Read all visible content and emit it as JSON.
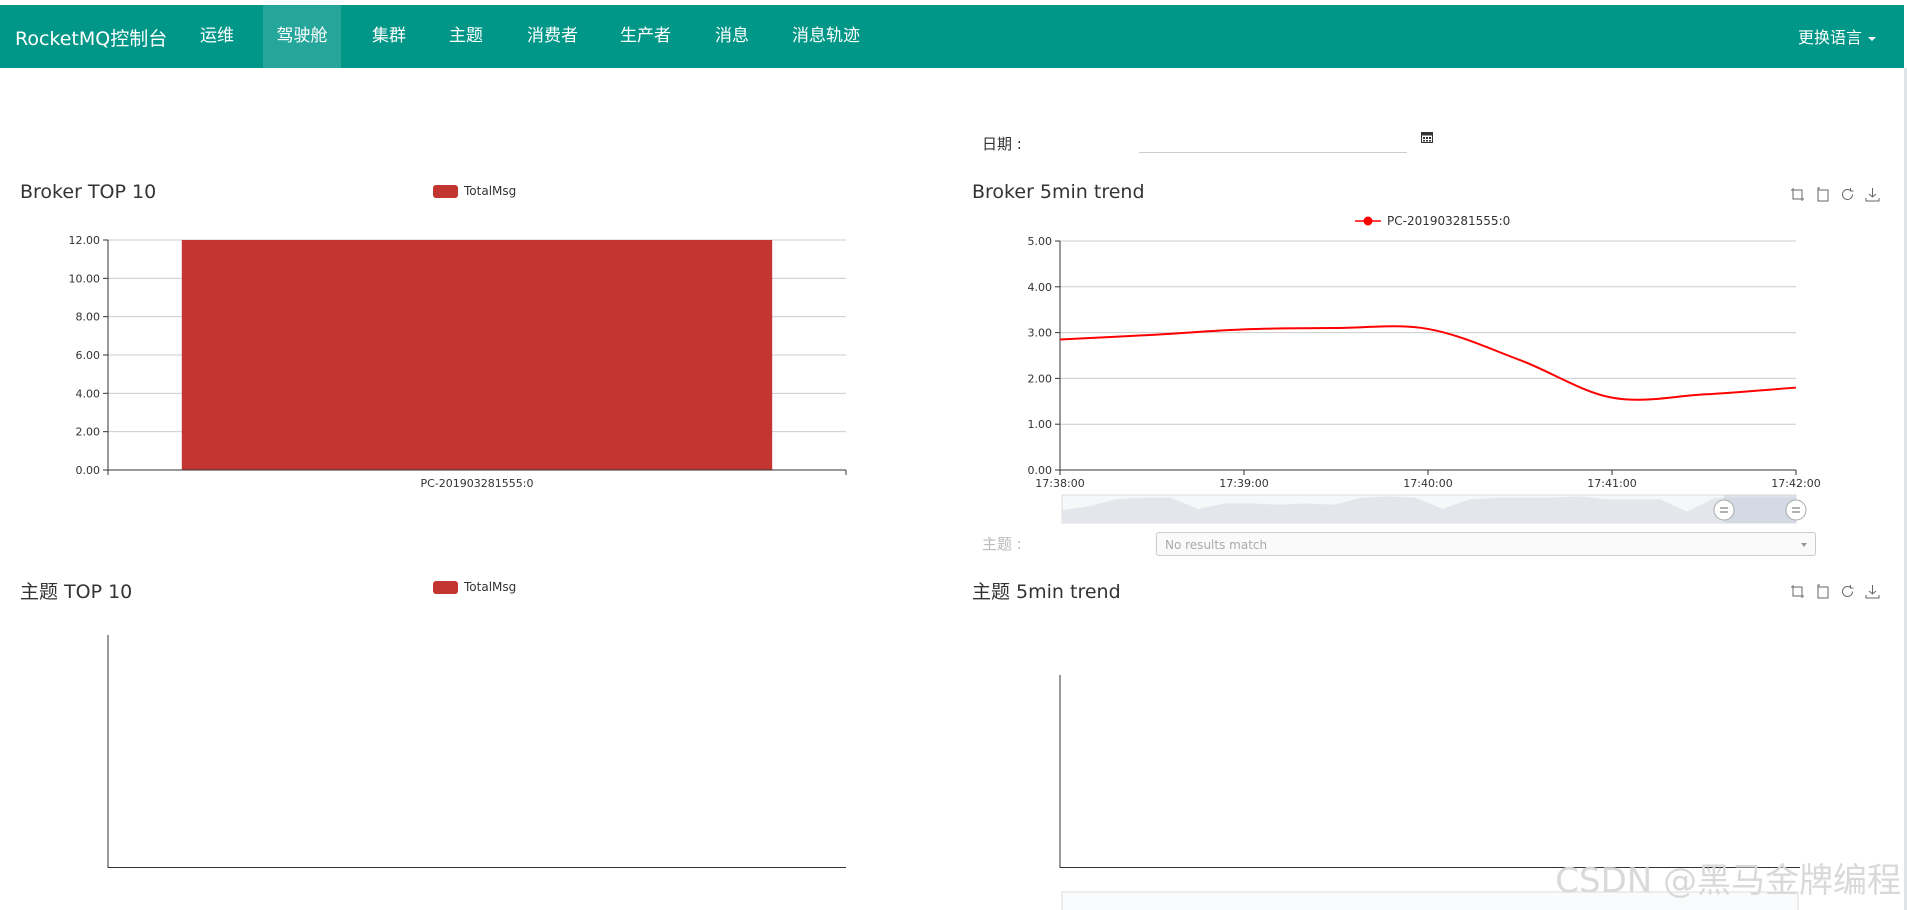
{
  "navbar": {
    "brand": "RocketMQ控制台",
    "items": [
      {
        "label": "运维",
        "active": false
      },
      {
        "label": "驾驶舱",
        "active": true
      },
      {
        "label": "集群",
        "active": false
      },
      {
        "label": "主题",
        "active": false
      },
      {
        "label": "消费者",
        "active": false
      },
      {
        "label": "生产者",
        "active": false
      },
      {
        "label": "消息",
        "active": false
      },
      {
        "label": "消息轨迹",
        "active": false
      }
    ],
    "language": "更换语言",
    "accent_color": "#009688",
    "active_color": "#26a69a"
  },
  "filters": {
    "date_label": "日期 :",
    "date_value": "",
    "calendar_icon": "calendar-icon",
    "topic_label": "主题 :",
    "topic_value": "No results match"
  },
  "panels": {
    "broker_top": {
      "title": "Broker TOP 10",
      "legend": "TotalMsg"
    },
    "broker_trend": {
      "title": "Broker 5min trend",
      "legend": "PC-201903281555:0"
    },
    "topic_top": {
      "title": "主题 TOP 10",
      "legend": "TotalMsg"
    },
    "topic_trend": {
      "title": "主题 5min trend"
    }
  },
  "toolbox_icons": [
    "zoom-icon",
    "zoom-reset-icon",
    "restore-icon",
    "download-icon"
  ],
  "chart_data": [
    {
      "type": "bar",
      "title": "Broker TOP 10",
      "legend": [
        "TotalMsg"
      ],
      "categories": [
        "PC-201903281555:0"
      ],
      "series": [
        {
          "name": "TotalMsg",
          "values": [
            12
          ]
        }
      ],
      "ylim": [
        0,
        12
      ],
      "yticks": [
        "0.00",
        "2.00",
        "4.00",
        "6.00",
        "8.00",
        "10.00",
        "12.00"
      ],
      "color": "#c23531",
      "grid": true
    },
    {
      "type": "line",
      "title": "Broker 5min trend",
      "legend": [
        "PC-201903281555:0"
      ],
      "x": [
        "17:38:00",
        "17:38:30",
        "17:39:00",
        "17:39:30",
        "17:40:00",
        "17:40:30",
        "17:41:00",
        "17:41:30",
        "17:42:00"
      ],
      "xticks": [
        "17:38:00",
        "17:39:00",
        "17:40:00",
        "17:41:00",
        "17:42:00"
      ],
      "series": [
        {
          "name": "PC-201903281555:0",
          "values": [
            2.85,
            2.95,
            3.07,
            3.1,
            3.08,
            2.4,
            1.58,
            1.65,
            1.8
          ]
        }
      ],
      "ylim": [
        0,
        5
      ],
      "yticks": [
        "0.00",
        "1.00",
        "2.00",
        "3.00",
        "4.00",
        "5.00"
      ],
      "color": "#ff0000",
      "grid": true
    },
    {
      "type": "bar",
      "title": "主题 TOP 10",
      "legend": [
        "TotalMsg"
      ],
      "categories": [],
      "series": [
        {
          "name": "TotalMsg",
          "values": []
        }
      ]
    },
    {
      "type": "line",
      "title": "主题 5min trend",
      "series": []
    }
  ],
  "watermark": "CSDN @黑马金牌编程",
  "watermark_small": "CSDN @[...]"
}
